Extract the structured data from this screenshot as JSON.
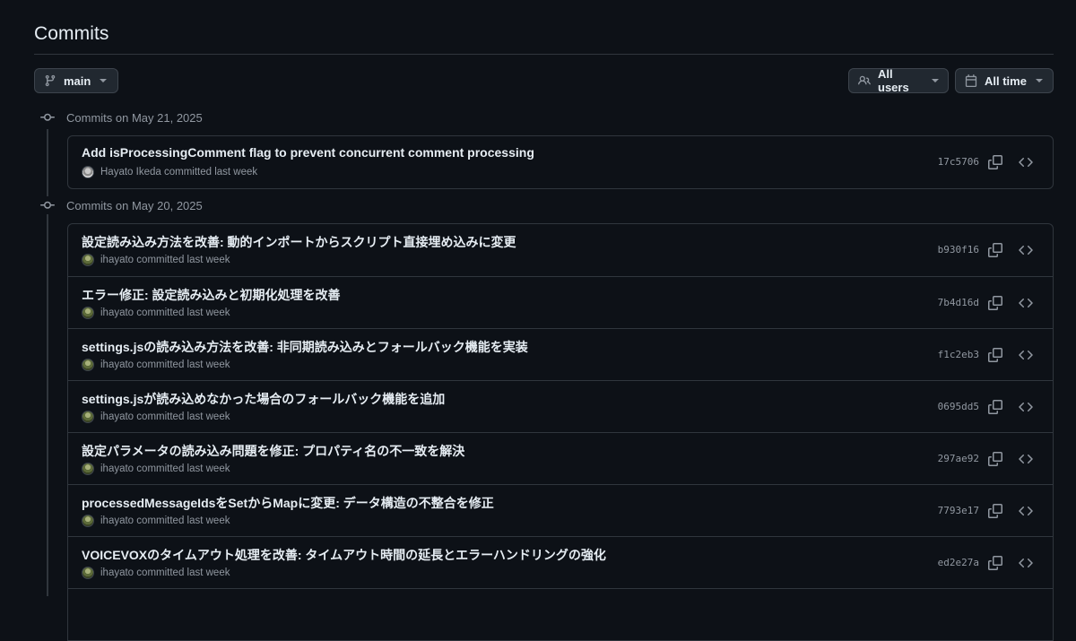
{
  "header": {
    "title": "Commits"
  },
  "toolbar": {
    "branch_label": "main",
    "branch_icon": "git-branch-icon",
    "users_label": "All users",
    "users_icon": "people-icon",
    "time_label": "All time",
    "time_icon": "calendar-icon"
  },
  "groups": [
    {
      "heading": "Commits on May 21, 2025",
      "commits": [
        {
          "message": "Add isProcessingComment flag to prevent concurrent comment processing",
          "author": "Hayato Ikeda",
          "action": "committed last week",
          "sha": "17c5706"
        }
      ]
    },
    {
      "heading": "Commits on May 20, 2025",
      "commits": [
        {
          "message": "設定読み込み方法を改善: 動的インポートからスクリプト直接埋め込みに変更",
          "author": "ihayato",
          "action": "committed last week",
          "sha": "b930f16"
        },
        {
          "message": "エラー修正: 設定読み込みと初期化処理を改善",
          "author": "ihayato",
          "action": "committed last week",
          "sha": "7b4d16d"
        },
        {
          "message": "settings.jsの読み込み方法を改善: 非同期読み込みとフォールバック機能を実装",
          "author": "ihayato",
          "action": "committed last week",
          "sha": "f1c2eb3"
        },
        {
          "message": "settings.jsが読み込めなかった場合のフォールバック機能を追加",
          "author": "ihayato",
          "action": "committed last week",
          "sha": "0695dd5"
        },
        {
          "message": "設定パラメータの読み込み問題を修正: プロパティ名の不一致を解決",
          "author": "ihayato",
          "action": "committed last week",
          "sha": "297ae92"
        },
        {
          "message": "processedMessageIdsをSetからMapに変更: データ構造の不整合を修正",
          "author": "ihayato",
          "action": "committed last week",
          "sha": "7793e17"
        },
        {
          "message": "VOICEVOXのタイムアウト処理を改善: タイムアウト時間の延長とエラーハンドリングの強化",
          "author": "ihayato",
          "action": "committed last week",
          "sha": "ed2e27a"
        }
      ]
    }
  ]
}
